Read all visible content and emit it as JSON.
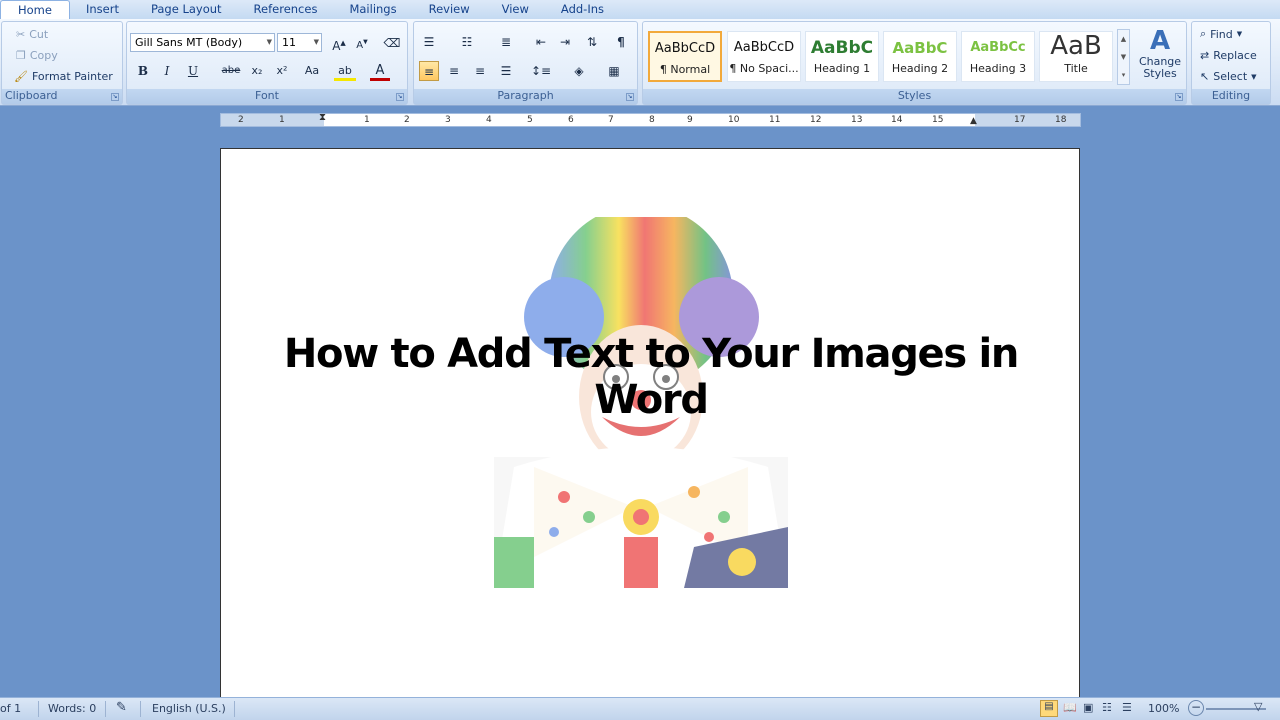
{
  "tabs": [
    {
      "label": "Home",
      "active": true
    },
    {
      "label": "Insert"
    },
    {
      "label": "Page Layout"
    },
    {
      "label": "References"
    },
    {
      "label": "Mailings"
    },
    {
      "label": "Review"
    },
    {
      "label": "View"
    },
    {
      "label": "Add-Ins"
    }
  ],
  "clipboard": {
    "label": "Clipboard",
    "cut": "Cut",
    "copy": "Copy",
    "format_painter": "Format Painter"
  },
  "font": {
    "label": "Font",
    "name": "Gill Sans MT (Body)",
    "size": "11",
    "bold": "B",
    "italic": "I",
    "underline": "U",
    "strike": "abe",
    "sub": "x₂",
    "sup": "x²",
    "case": "Aa",
    "color": "A",
    "highlight": "ab"
  },
  "paragraph": {
    "label": "Paragraph"
  },
  "styles": {
    "label": "Styles",
    "items": [
      {
        "preview": "AaBbCcD",
        "name": "¶ Normal",
        "selected": true
      },
      {
        "preview": "AaBbCcD",
        "name": "¶ No Spaci..."
      },
      {
        "preview": "AaBbC",
        "name": "Heading 1"
      },
      {
        "preview": "AaBbC",
        "name": "Heading 2"
      },
      {
        "preview": "AaBbCc",
        "name": "Heading 3"
      },
      {
        "preview": "AaB",
        "name": "Title"
      }
    ],
    "change_styles": "Change Styles"
  },
  "editing": {
    "label": "Editing",
    "find": "Find",
    "replace": "Replace",
    "select": "Select"
  },
  "ruler": {
    "numbers": [
      "2",
      "1",
      "1",
      "2",
      "3",
      "4",
      "5",
      "6",
      "7",
      "8",
      "9",
      "10",
      "11",
      "12",
      "13",
      "14",
      "15",
      "17",
      "18"
    ]
  },
  "document": {
    "heading": "How to Add Text to Your Images in Word"
  },
  "status": {
    "page": "of 1",
    "words": "Words: 0",
    "language": "English (U.S.)",
    "zoom": "100%"
  },
  "colors": {
    "ribbon": "#dfeaf8",
    "workspace": "#6b93c9",
    "accent": "#15428b",
    "heading1": "#2e7d32",
    "heading2": "#7cc242"
  }
}
